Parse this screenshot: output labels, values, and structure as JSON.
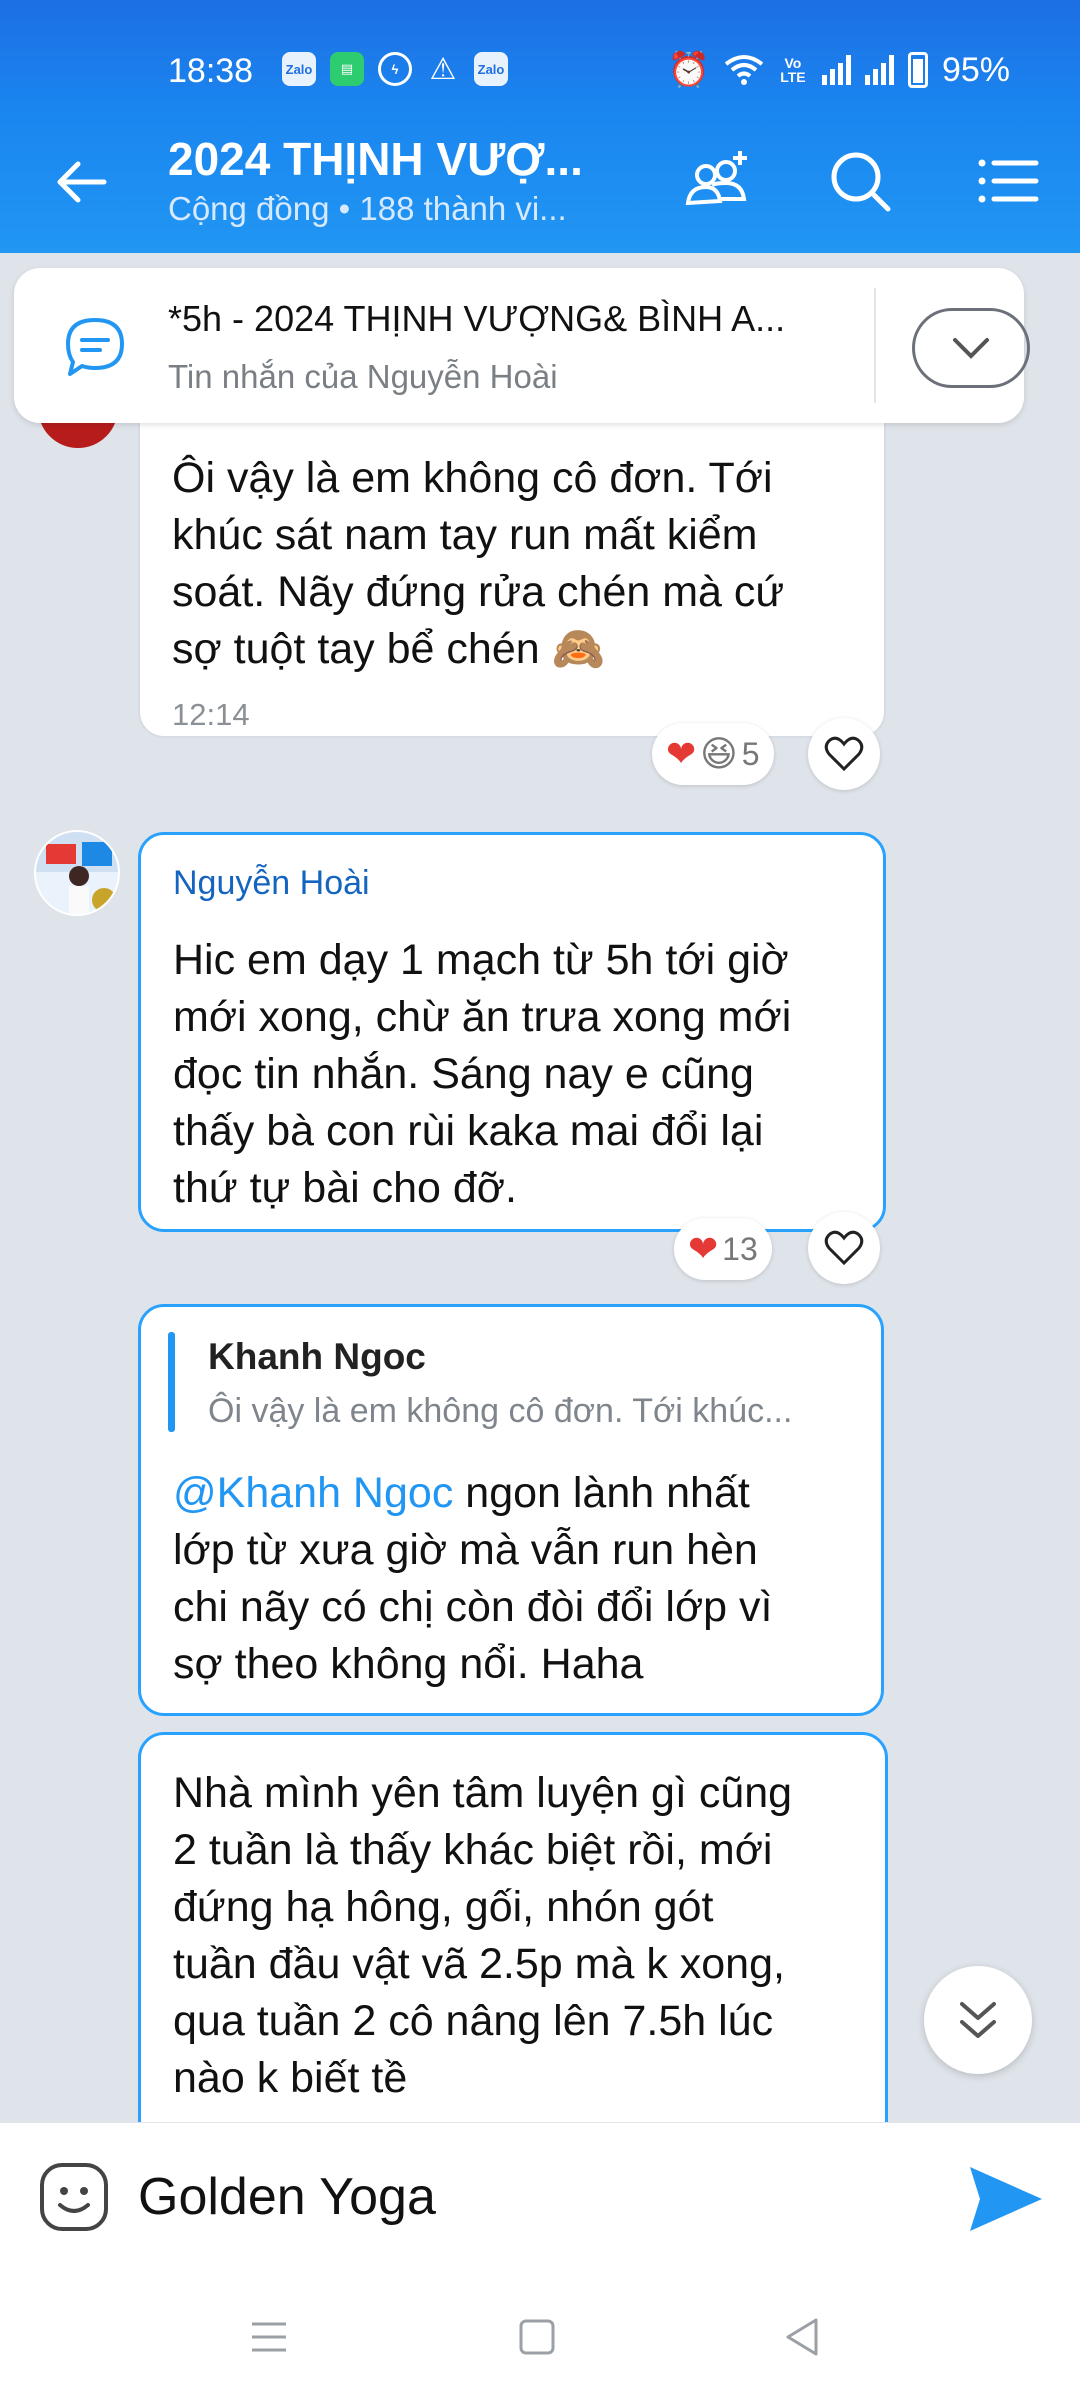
{
  "status_bar": {
    "time": "18:38",
    "notif_icons": [
      "Zalo",
      "messages-icon",
      "messenger-icon",
      "warning-icon",
      "Zalo"
    ],
    "volte": "Vo LTE",
    "battery": "95%"
  },
  "header": {
    "title": "2024 THỊNH VƯỢ...",
    "subtitle": "Cộng đồng • 188 thành vi..."
  },
  "pinned": {
    "title": "*5h - 2024 THỊNH VƯỢNG& BÌNH A...",
    "subtitle": "Tin nhắn của Nguyễn Hoài"
  },
  "messages": [
    {
      "lines": [
        "Ôi vậy là em không cô đơn. Tới",
        "khúc sát   nam tay run mất kiểm",
        "soát. Nãy đứng rửa chén mà cứ",
        "sợ tuột tay bể chén 🙈"
      ],
      "time": "12:14",
      "reaction_count": "5"
    },
    {
      "sender": "Nguyễn Hoài",
      "lines": [
        "Hic em dạy 1 mạch từ 5h tới giờ",
        "mới xong, chừ ăn trưa xong mới",
        "đọc tin nhắn. Sáng nay e cũng",
        "thấy bà con rùi kaka mai đổi lại",
        "thứ tự bài cho đỡ."
      ],
      "reaction_count": "13"
    },
    {
      "quote_name": "Khanh Ngoc",
      "quote_text": "Ôi vậy là em không cô đơn. Tới khúc...",
      "mention": "@Khanh Ngoc",
      "first_line_rest": " ngon lành nhất",
      "lines": [
        "lớp từ xưa giờ mà vẫn run hèn",
        "chi nãy có chị còn đòi đổi lớp vì",
        "sợ theo không nổi. Haha"
      ]
    },
    {
      "lines": [
        "Nhà mình yên tâm luyện gì cũng",
        "2 tuần là thấy khác biệt rồi, mới",
        "đứng hạ hông, gối, nhón gót",
        "tuần đầu vật vã 2.5p mà k xong,",
        "qua tuần 2 cô nâng lên 7.5h lúc",
        "nào k biết tề"
      ]
    }
  ],
  "input": {
    "value": "Golden Yoga"
  },
  "colors": {
    "header_blue": "#1a86f0",
    "accent": "#2196f3",
    "bubble_border": "#29a2ff"
  }
}
